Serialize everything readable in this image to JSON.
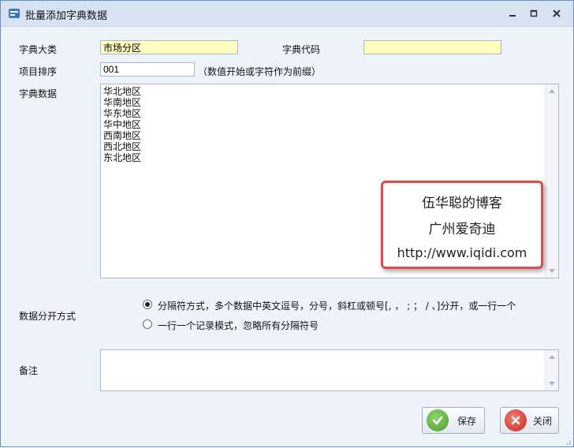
{
  "window": {
    "title": "批量添加字典数据"
  },
  "form": {
    "category_label": "字典大类",
    "category_value": "市场分区",
    "code_label": "字典代码",
    "code_value": "",
    "order_label": "项目排序",
    "order_value": "001",
    "order_hint": "（数值开始或字符作为前缀）",
    "data_label": "字典数据",
    "data_lines": [
      "华北地区",
      "华南地区",
      "华东地区",
      "华中地区",
      "西南地区",
      "西北地区",
      "东北地区"
    ],
    "split_label": "数据分开方式",
    "split_options": [
      {
        "label": "分隔符方式，多个数据中英文逗号，分号，斜杠或顿号[, ， ; ； / 、]分开，或一行一个",
        "checked": true
      },
      {
        "label": "一行一个记录模式，忽略所有分隔符号",
        "checked": false
      }
    ],
    "remark_label": "备注",
    "remark_value": ""
  },
  "watermark": {
    "line1": "伍华聪的博客",
    "line2": "广州爱奇迪",
    "line3": "http://www.iqidi.com"
  },
  "buttons": {
    "save_label": "保存",
    "close_label": "关闭"
  },
  "icons": {
    "app": "dictionary-app-icon",
    "minimize": "minimize-icon",
    "maximize": "maximize-icon",
    "close": "close-icon",
    "save": "check-icon",
    "cancel": "x-circle-icon"
  },
  "colors": {
    "accent_yellow": "#ffffc0",
    "save_green": "#5ab13c",
    "close_red": "#d9352c",
    "watermark_border": "#e04b4b"
  }
}
